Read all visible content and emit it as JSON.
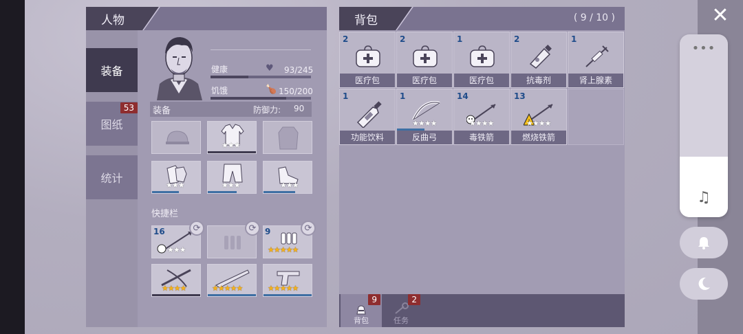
{
  "character": {
    "title": "人物",
    "tabs": [
      {
        "label": "装备",
        "active": true
      },
      {
        "label": "图纸",
        "badge": "53"
      },
      {
        "label": "统计"
      }
    ],
    "stats": {
      "health": {
        "label": "健康",
        "value": "93/245",
        "fraction": 0.38
      },
      "hunger": {
        "label": "饥饿",
        "value": "150/200",
        "fraction": 0.75
      }
    },
    "equipment": {
      "label": "装备",
      "defense_label": "防御力:",
      "defense_value": "90"
    },
    "equip_slots": [
      {
        "item": "helmet",
        "filled": false
      },
      {
        "item": "jacket",
        "filled": true,
        "stars": "★★★"
      },
      {
        "item": "shirt",
        "filled": false
      },
      {
        "item": "gloves",
        "filled": true,
        "stars": "★★★"
      },
      {
        "item": "pants",
        "filled": true,
        "stars": "★★★"
      },
      {
        "item": "shoes",
        "filled": true,
        "stars": "★★★"
      }
    ],
    "quickbar": {
      "label": "快捷栏"
    },
    "quick_slots": [
      {
        "count": "16",
        "item": "poison-arrow",
        "stars": "★★★",
        "star_color": "white"
      },
      {
        "count": "",
        "item": "bullets",
        "stars": "",
        "star_color": ""
      },
      {
        "count": "9",
        "item": "shotgun-shells",
        "stars": "★★★★★",
        "star_color": "gold"
      },
      {
        "count": "",
        "item": "crossbow",
        "stars": "★★★★",
        "star_color": "gold"
      },
      {
        "count": "",
        "item": "shotgun",
        "stars": "★★★★★",
        "star_color": "gold"
      },
      {
        "count": "",
        "item": "revolver",
        "stars": "★★★★★",
        "star_color": "gold"
      }
    ]
  },
  "backpack": {
    "title": "背包",
    "capacity": "( 9 / 10 )",
    "items": [
      {
        "count": "2",
        "label": "医疗包",
        "icon": "medkit-icon"
      },
      {
        "count": "2",
        "label": "医疗包",
        "icon": "medkit-icon"
      },
      {
        "count": "1",
        "label": "医疗包",
        "icon": "medkit-icon"
      },
      {
        "count": "2",
        "label": "抗毒剂",
        "icon": "antidote-icon"
      },
      {
        "count": "1",
        "label": "肾上腺素",
        "icon": "syringe-icon"
      },
      {
        "count": "1",
        "label": "功能饮料",
        "icon": "energy-drink-icon"
      },
      {
        "count": "1",
        "label": "反曲弓",
        "icon": "bow-icon",
        "stars": "★★★★"
      },
      {
        "count": "14",
        "label": "毒铁箭",
        "icon": "poison-arrow-icon",
        "stars": "★★★★"
      },
      {
        "count": "13",
        "label": "燃烧铁箭",
        "icon": "fire-arrow-icon",
        "stars": "★★★★"
      }
    ],
    "bottom_tabs": [
      {
        "label": "背包",
        "badge": "9",
        "active": true
      },
      {
        "label": "任务",
        "badge": "2",
        "active": false
      }
    ]
  },
  "overlay": {
    "close": "✕",
    "volume_dots": "•••",
    "volume_level": 0.33,
    "music_icon": "♫",
    "bell_icon": "bell-icon",
    "moon_icon": "moon-icon"
  }
}
